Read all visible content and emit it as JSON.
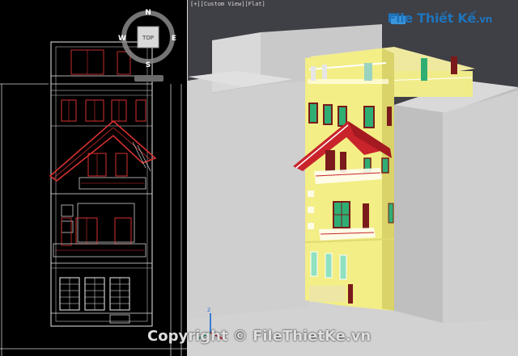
{
  "left_viewport": {
    "viewcube": {
      "face_label": "TOP",
      "compass": {
        "north": "N",
        "south": "S",
        "east": "E",
        "west": "W"
      }
    }
  },
  "right_viewport": {
    "label": "[+][Custom View][Flat]",
    "axis_label": "z"
  },
  "watermark": {
    "brand_name": "File Thiết Kế",
    "brand_domain": ".vn",
    "copyright": "Copyright © FileThietKe.vn"
  },
  "colors": {
    "facade": "#f0ec8a",
    "roof": "#c9232b",
    "window_frame": "#7a1a1a",
    "glass": "#2fae74",
    "neighbor_building": "#c9c9c9",
    "sky": "#3f3f46",
    "ground": "#d2d2d2",
    "brand": "#1e74bb"
  }
}
